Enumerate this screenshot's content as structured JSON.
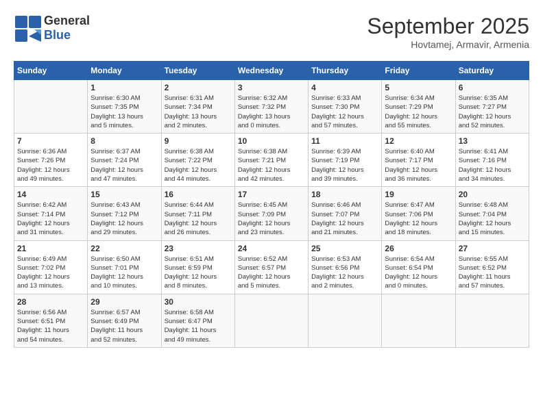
{
  "header": {
    "logo_general": "General",
    "logo_blue": "Blue",
    "month": "September 2025",
    "location": "Hovtamej, Armavir, Armenia"
  },
  "weekdays": [
    "Sunday",
    "Monday",
    "Tuesday",
    "Wednesday",
    "Thursday",
    "Friday",
    "Saturday"
  ],
  "weeks": [
    [
      {
        "day": "",
        "info": ""
      },
      {
        "day": "1",
        "info": "Sunrise: 6:30 AM\nSunset: 7:35 PM\nDaylight: 13 hours\nand 5 minutes."
      },
      {
        "day": "2",
        "info": "Sunrise: 6:31 AM\nSunset: 7:34 PM\nDaylight: 13 hours\nand 2 minutes."
      },
      {
        "day": "3",
        "info": "Sunrise: 6:32 AM\nSunset: 7:32 PM\nDaylight: 13 hours\nand 0 minutes."
      },
      {
        "day": "4",
        "info": "Sunrise: 6:33 AM\nSunset: 7:30 PM\nDaylight: 12 hours\nand 57 minutes."
      },
      {
        "day": "5",
        "info": "Sunrise: 6:34 AM\nSunset: 7:29 PM\nDaylight: 12 hours\nand 55 minutes."
      },
      {
        "day": "6",
        "info": "Sunrise: 6:35 AM\nSunset: 7:27 PM\nDaylight: 12 hours\nand 52 minutes."
      }
    ],
    [
      {
        "day": "7",
        "info": "Sunrise: 6:36 AM\nSunset: 7:26 PM\nDaylight: 12 hours\nand 49 minutes."
      },
      {
        "day": "8",
        "info": "Sunrise: 6:37 AM\nSunset: 7:24 PM\nDaylight: 12 hours\nand 47 minutes."
      },
      {
        "day": "9",
        "info": "Sunrise: 6:38 AM\nSunset: 7:22 PM\nDaylight: 12 hours\nand 44 minutes."
      },
      {
        "day": "10",
        "info": "Sunrise: 6:38 AM\nSunset: 7:21 PM\nDaylight: 12 hours\nand 42 minutes."
      },
      {
        "day": "11",
        "info": "Sunrise: 6:39 AM\nSunset: 7:19 PM\nDaylight: 12 hours\nand 39 minutes."
      },
      {
        "day": "12",
        "info": "Sunrise: 6:40 AM\nSunset: 7:17 PM\nDaylight: 12 hours\nand 36 minutes."
      },
      {
        "day": "13",
        "info": "Sunrise: 6:41 AM\nSunset: 7:16 PM\nDaylight: 12 hours\nand 34 minutes."
      }
    ],
    [
      {
        "day": "14",
        "info": "Sunrise: 6:42 AM\nSunset: 7:14 PM\nDaylight: 12 hours\nand 31 minutes."
      },
      {
        "day": "15",
        "info": "Sunrise: 6:43 AM\nSunset: 7:12 PM\nDaylight: 12 hours\nand 29 minutes."
      },
      {
        "day": "16",
        "info": "Sunrise: 6:44 AM\nSunset: 7:11 PM\nDaylight: 12 hours\nand 26 minutes."
      },
      {
        "day": "17",
        "info": "Sunrise: 6:45 AM\nSunset: 7:09 PM\nDaylight: 12 hours\nand 23 minutes."
      },
      {
        "day": "18",
        "info": "Sunrise: 6:46 AM\nSunset: 7:07 PM\nDaylight: 12 hours\nand 21 minutes."
      },
      {
        "day": "19",
        "info": "Sunrise: 6:47 AM\nSunset: 7:06 PM\nDaylight: 12 hours\nand 18 minutes."
      },
      {
        "day": "20",
        "info": "Sunrise: 6:48 AM\nSunset: 7:04 PM\nDaylight: 12 hours\nand 15 minutes."
      }
    ],
    [
      {
        "day": "21",
        "info": "Sunrise: 6:49 AM\nSunset: 7:02 PM\nDaylight: 12 hours\nand 13 minutes."
      },
      {
        "day": "22",
        "info": "Sunrise: 6:50 AM\nSunset: 7:01 PM\nDaylight: 12 hours\nand 10 minutes."
      },
      {
        "day": "23",
        "info": "Sunrise: 6:51 AM\nSunset: 6:59 PM\nDaylight: 12 hours\nand 8 minutes."
      },
      {
        "day": "24",
        "info": "Sunrise: 6:52 AM\nSunset: 6:57 PM\nDaylight: 12 hours\nand 5 minutes."
      },
      {
        "day": "25",
        "info": "Sunrise: 6:53 AM\nSunset: 6:56 PM\nDaylight: 12 hours\nand 2 minutes."
      },
      {
        "day": "26",
        "info": "Sunrise: 6:54 AM\nSunset: 6:54 PM\nDaylight: 12 hours\nand 0 minutes."
      },
      {
        "day": "27",
        "info": "Sunrise: 6:55 AM\nSunset: 6:52 PM\nDaylight: 11 hours\nand 57 minutes."
      }
    ],
    [
      {
        "day": "28",
        "info": "Sunrise: 6:56 AM\nSunset: 6:51 PM\nDaylight: 11 hours\nand 54 minutes."
      },
      {
        "day": "29",
        "info": "Sunrise: 6:57 AM\nSunset: 6:49 PM\nDaylight: 11 hours\nand 52 minutes."
      },
      {
        "day": "30",
        "info": "Sunrise: 6:58 AM\nSunset: 6:47 PM\nDaylight: 11 hours\nand 49 minutes."
      },
      {
        "day": "",
        "info": ""
      },
      {
        "day": "",
        "info": ""
      },
      {
        "day": "",
        "info": ""
      },
      {
        "day": "",
        "info": ""
      }
    ]
  ]
}
